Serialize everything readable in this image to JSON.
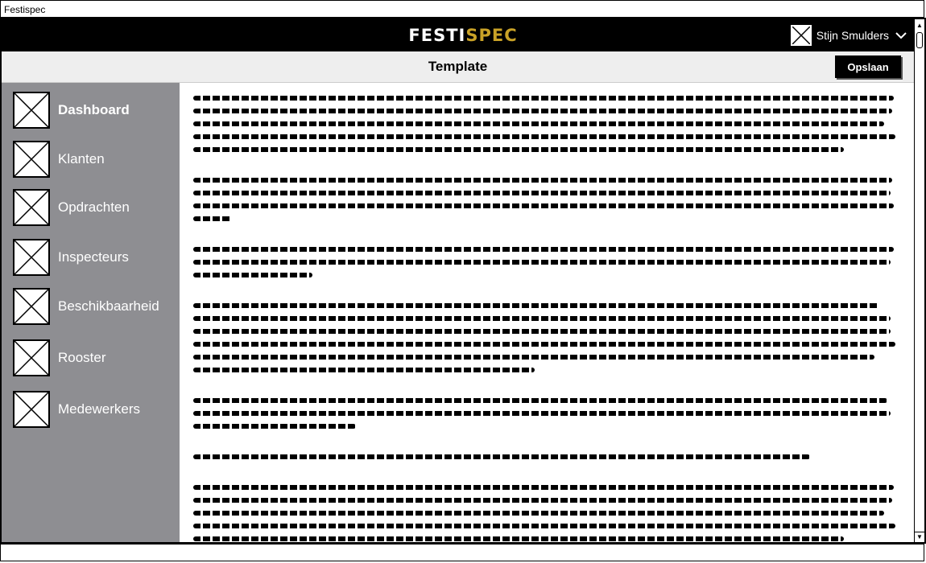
{
  "window": {
    "title": "Festispec"
  },
  "header": {
    "brand_main": "FESTI",
    "brand_accent": "SPEC",
    "user_name": "Stijn Smulders"
  },
  "subheader": {
    "page_title": "Template",
    "save_label": "Opslaan"
  },
  "sidebar": {
    "items": [
      {
        "label": "Dashboard",
        "active": true
      },
      {
        "label": "Klanten"
      },
      {
        "label": "Opdrachten"
      },
      {
        "label": "Inspecteurs"
      },
      {
        "label": "Beschikbaarheid"
      },
      {
        "label": "Rooster"
      },
      {
        "label": "Medewerkers"
      }
    ]
  },
  "colors": {
    "header_bg": "#000000",
    "brand_accent": "#c9a227",
    "sidebar_bg": "#8e8e92"
  }
}
